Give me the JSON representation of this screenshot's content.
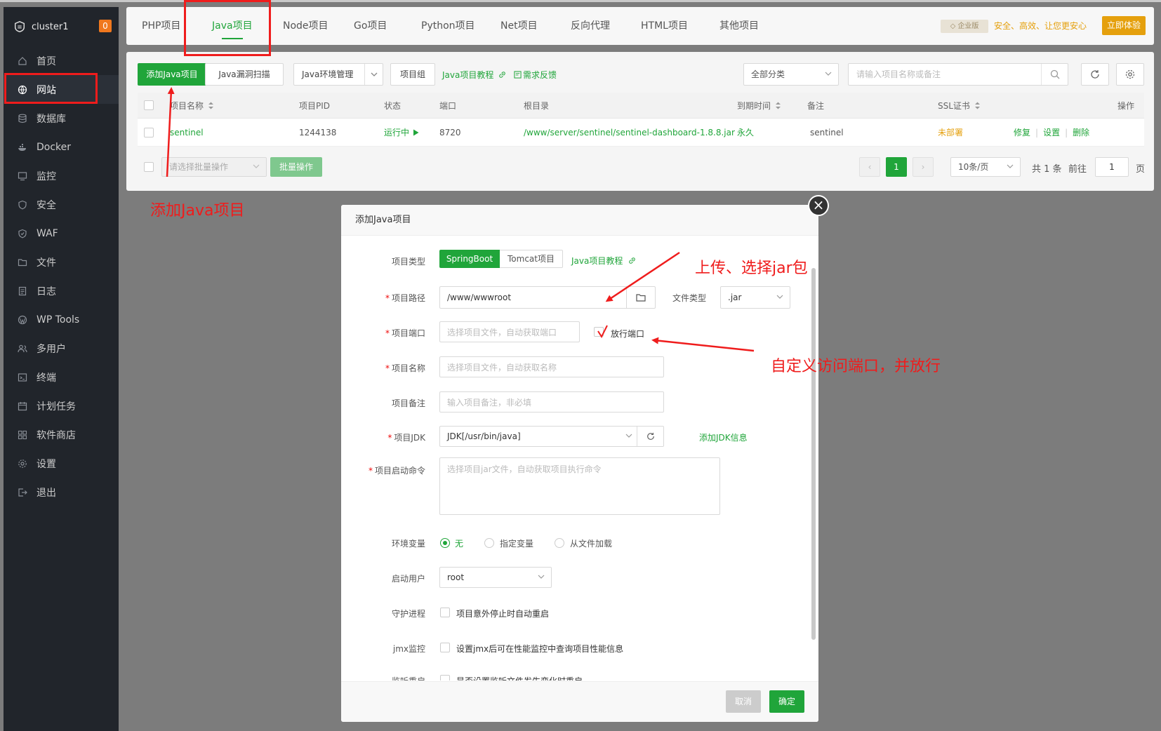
{
  "sidebar": {
    "server_name": "cluster1",
    "badge_count": "0",
    "items": [
      {
        "label": "首页",
        "icon": "home-icon"
      },
      {
        "label": "网站",
        "icon": "globe-icon",
        "active": true
      },
      {
        "label": "数据库",
        "icon": "database-icon"
      },
      {
        "label": "Docker",
        "icon": "docker-icon"
      },
      {
        "label": "监控",
        "icon": "monitor-icon"
      },
      {
        "label": "安全",
        "icon": "shield-icon"
      },
      {
        "label": "WAF",
        "icon": "waf-icon"
      },
      {
        "label": "文件",
        "icon": "folder-icon"
      },
      {
        "label": "日志",
        "icon": "log-icon"
      },
      {
        "label": "WP Tools",
        "icon": "wordpress-icon"
      },
      {
        "label": "多用户",
        "icon": "users-icon"
      },
      {
        "label": "终端",
        "icon": "terminal-icon"
      },
      {
        "label": "计划任务",
        "icon": "calendar-icon"
      },
      {
        "label": "软件商店",
        "icon": "apps-icon"
      },
      {
        "label": "设置",
        "icon": "gear-icon"
      },
      {
        "label": "退出",
        "icon": "logout-icon"
      }
    ]
  },
  "tabs": [
    "PHP项目",
    "Java项目",
    "Node项目",
    "Go项目",
    "Python项目",
    "Net项目",
    "反向代理",
    "HTML项目",
    "其他项目"
  ],
  "active_tab": "Java项目",
  "enterprise": {
    "badge": "企业版",
    "slogan": "安全、高效、让您更安心",
    "button": "立即体验"
  },
  "toolbar": {
    "add_button": "添加Java项目",
    "scan_button": "Java漏洞扫描",
    "env_button": "Java环境管理",
    "group_button": "项目组",
    "tutorial_link": "Java项目教程",
    "feedback_link": "需求反馈",
    "category_select": "全部分类",
    "search_placeholder": "请输入项目名称或备注"
  },
  "table": {
    "headers": [
      "项目名称",
      "项目PID",
      "状态",
      "端口",
      "根目录",
      "到期时间",
      "备注",
      "SSL证书",
      "操作"
    ],
    "rows": [
      {
        "name": "sentinel",
        "pid": "1244138",
        "status": "运行中",
        "port": "8720",
        "root": "/www/server/sentinel/sentinel-dashboard-1.8.8.jar",
        "expire": "永久",
        "remark": "sentinel",
        "ssl": "未部署",
        "actions": [
          "修复",
          "设置",
          "删除"
        ]
      }
    ]
  },
  "batch": {
    "select_placeholder": "请选择批量操作",
    "button": "批量操作"
  },
  "pagination": {
    "current": "1",
    "per_page": "10条/页",
    "total": "共 1 条",
    "goto_label": "前往",
    "goto_value": "1",
    "page_suffix": "页"
  },
  "modal": {
    "title": "添加Java项目",
    "project_type_label": "项目类型",
    "type_springboot": "SpringBoot",
    "type_tomcat": "Tomcat项目",
    "tutorial_link": "Java项目教程",
    "path_label": "项目路径",
    "path_value": "/www/wwwroot",
    "file_type_label": "文件类型",
    "file_type_value": ".jar",
    "port_label": "项目端口",
    "port_placeholder": "选择项目文件，自动获取端口",
    "release_port_label": "放行端口",
    "name_label": "项目名称",
    "name_placeholder": "选择项目文件，自动获取名称",
    "remark_label": "项目备注",
    "remark_placeholder": "输入项目备注，非必填",
    "jdk_label": "项目JDK",
    "jdk_value": "JDK[/usr/bin/java]",
    "add_jdk_link": "添加JDK信息",
    "cmd_label": "项目启动命令",
    "cmd_placeholder": "选择项目jar文件，自动获取项目执行命令",
    "env_label": "环境变量",
    "env_options": [
      "无",
      "指定变量",
      "从文件加载"
    ],
    "user_label": "启动用户",
    "user_value": "root",
    "daemon_label": "守护进程",
    "daemon_text": "项目意外停止时自动重启",
    "jmx_label": "jmx监控",
    "jmx_text": "设置jmx后可在性能监控中查询项目性能信息",
    "listen_label": "监听重启",
    "listen_text": "是否设置监听文件发生变化时重启",
    "cancel": "取消",
    "confirm": "确定"
  },
  "annotations": {
    "add_project": "添加Java项目",
    "upload_jar": "上传、选择jar包",
    "custom_port": "自定义访问端口，并放行"
  },
  "colors": {
    "accent": "#20a53a",
    "annotation": "#ef1c1c",
    "sidebar_bg": "#21252b",
    "enterprise": "#e5a00d"
  }
}
